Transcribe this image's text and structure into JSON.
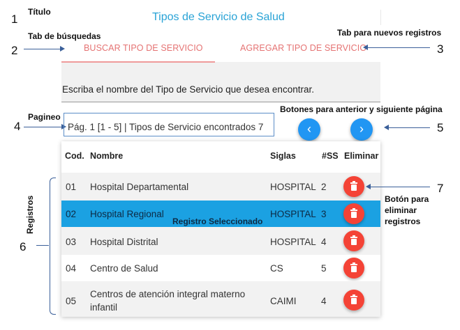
{
  "page_title": "Tipos de Servicio de Salud",
  "annotations": {
    "titulo": "Título",
    "tab_busquedas": "Tab de búsquedas",
    "tab_nuevos": "Tab para nuevos registros",
    "pagineo": "Pagineo",
    "botones": "Botones para anterior y siguiente página",
    "boton_eliminar": "Botón para eliminar registros",
    "registros": "Registros",
    "registro_seleccionado": "Registro Seleccionado",
    "numbers": [
      "1",
      "2",
      "3",
      "4",
      "5",
      "6",
      "7"
    ]
  },
  "tabs": [
    {
      "label": "BUSCAR TIPO DE SERVICIO",
      "active": true
    },
    {
      "label": "AGREGAR TIPO DE SERVICIO",
      "active": false
    }
  ],
  "search": {
    "text": "Escriba el nombre del Tipo de Servicio que desea encontrar."
  },
  "pager": {
    "text": "Pág. 1 [1 - 5] | Tipos de Servicio encontrados 7"
  },
  "table": {
    "headers": [
      "Cod.",
      "Nombre",
      "Siglas",
      "#SS",
      "Eliminar"
    ],
    "rows": [
      {
        "cod": "01",
        "nombre": "Hospital Departamental",
        "siglas": "HOSPITAL",
        "ss": "2",
        "selected": false
      },
      {
        "cod": "02",
        "nombre": "Hospital Regional",
        "siglas": "HOSPITAL",
        "ss": "3",
        "selected": true
      },
      {
        "cod": "03",
        "nombre": "Hospital Distrital",
        "siglas": "HOSPITAL",
        "ss": "4",
        "selected": false
      },
      {
        "cod": "04",
        "nombre": "Centro de Salud",
        "siglas": "CS",
        "ss": "5",
        "selected": false
      },
      {
        "cod": "05",
        "nombre": "Centros de atención integral materno infantil",
        "siglas": "CAIMI",
        "ss": "4",
        "selected": false
      }
    ]
  },
  "colors": {
    "accent": "#2196f3",
    "delete": "#f44336",
    "selected_row": "#1ba1e2",
    "title": "#29a3d6",
    "tab": "#e57373"
  }
}
